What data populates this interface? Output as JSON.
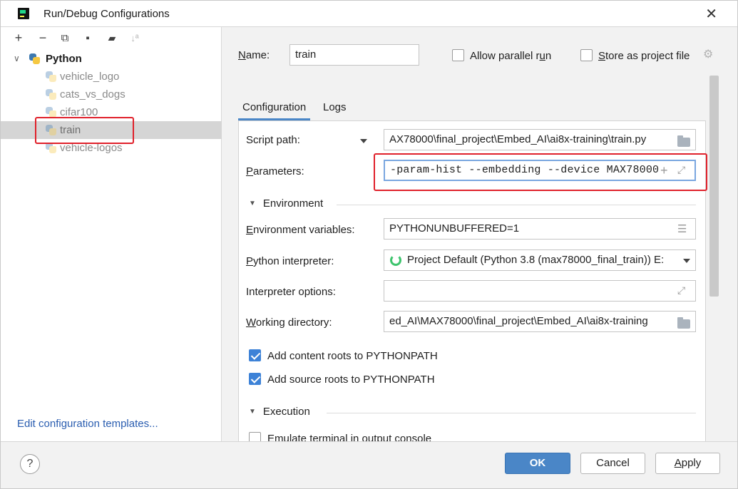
{
  "window": {
    "title": "Run/Debug Configurations",
    "close_glyph": "✕"
  },
  "toolbar": {
    "add": "+",
    "remove": "−",
    "copy": "⧉",
    "save": "▪",
    "folder": "▰",
    "sort": "↓ª"
  },
  "tree": {
    "expand_glyph": "∨",
    "root": "Python",
    "items": [
      {
        "label": "vehicle_logo"
      },
      {
        "label": "cats_vs_dogs"
      },
      {
        "label": "cifar100"
      },
      {
        "label": "train"
      },
      {
        "label": "vehicle-logos"
      }
    ]
  },
  "edit_templates_link": "Edit configuration templates...",
  "name_row": {
    "label_pre": "",
    "label_u": "N",
    "label_post": "ame:",
    "value": "train",
    "allow_parallel_pre": "Allow parallel r",
    "allow_parallel_u": "u",
    "allow_parallel_post": "n",
    "store_pre": "",
    "store_u": "S",
    "store_post": "tore as project file"
  },
  "tabs": [
    {
      "label": "Configuration"
    },
    {
      "label": "Logs"
    }
  ],
  "config": {
    "script_path_label": "Script path:",
    "script_path_value": "AX78000\\final_project\\Embed_AI\\ai8x-training\\train.py",
    "parameters_label_u": "P",
    "parameters_label_post": "arameters:",
    "parameters_value": "-param-hist --embedding --device MAX78000",
    "environment_header": "Environment",
    "env_vars_label_u": "E",
    "env_vars_label_post": "nvironment variables:",
    "env_vars_value": "PYTHONUNBUFFERED=1",
    "interpreter_label_u": "P",
    "interpreter_label_post": "ython interpreter:",
    "interpreter_value": "Project Default (Python 3.8 (max78000_final_train)) E:",
    "interp_options_label": "Interpreter options:",
    "interp_options_value": "",
    "working_dir_label_u": "W",
    "working_dir_label_post": "orking directory:",
    "working_dir_value": "ed_AI\\MAX78000\\final_project\\Embed_AI\\ai8x-training",
    "content_roots_label": "Add content roots to PYTHONPATH",
    "source_roots_label": "Add source roots to PYTHONPATH",
    "execution_header": "Execution",
    "emulate_terminal_label": "Emulate terminal in output console"
  },
  "footer": {
    "help": "?",
    "ok": "OK",
    "cancel": "Cancel",
    "apply_u": "A",
    "apply_post": "pply"
  },
  "colors": {
    "accent": "#4a86c7",
    "highlight_red": "#e0212b",
    "checkbox_on": "#3d82d7",
    "link": "#2a5db0"
  },
  "icons": {
    "python": "python-icon",
    "folder": "folder-icon",
    "gear": "gear-icon",
    "expand": "expand-icon",
    "list": "list-icon"
  }
}
